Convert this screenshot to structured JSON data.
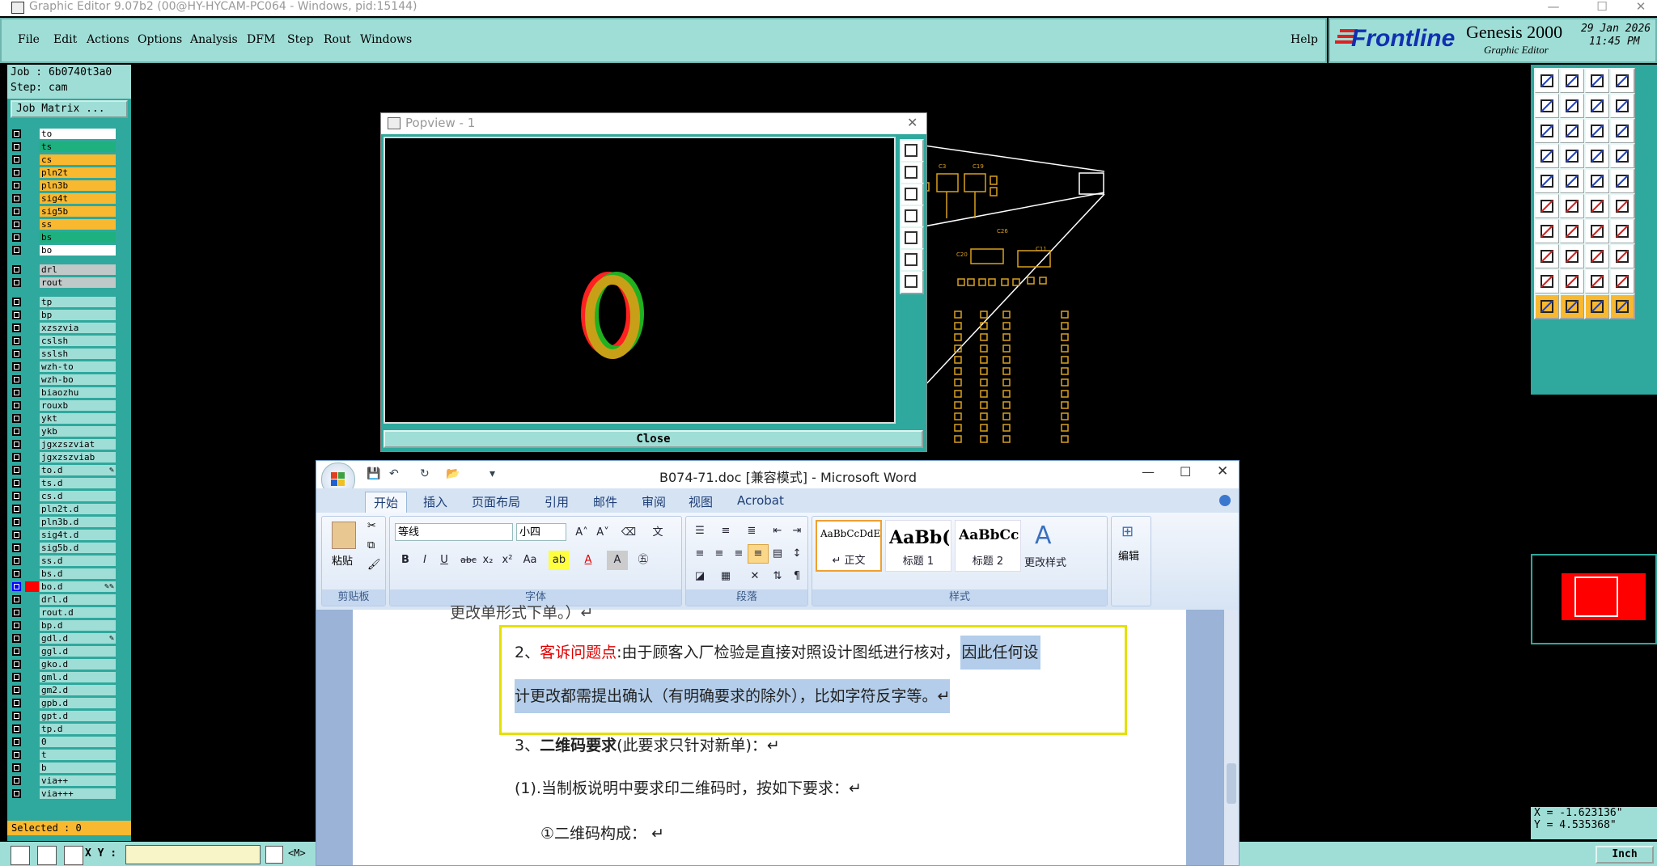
{
  "app": {
    "title": "Graphic Editor 9.07b2 (00@HY-HYCAM-PC064 - Windows, pid:15144)",
    "window_controls": [
      "—",
      "☐",
      "✕"
    ]
  },
  "menu": {
    "items": [
      "File",
      "Edit",
      "Actions",
      "Options",
      "Analysis",
      "DFM",
      "Step",
      "Rout",
      "Windows"
    ],
    "help": "Help"
  },
  "brand": {
    "logo": "Frontline",
    "product": "Genesis 2000",
    "subtitle": "Graphic Editor",
    "date": "29 Jan 2026",
    "time": "11:45 PM"
  },
  "job": {
    "job_line": "Job : 6b0740t3a0",
    "step_line": "Step: cam",
    "matrix_button": "Job Matrix ..."
  },
  "layers": [
    {
      "name": "to",
      "bg": "#ffffff",
      "col": "#2fa89d"
    },
    {
      "name": "ts",
      "bg": "#1fb080",
      "col": "#2fa89d"
    },
    {
      "name": "cs",
      "bg": "#f8b830",
      "col": "#2fa89d"
    },
    {
      "name": "pln2t",
      "bg": "#f8b830",
      "col": "#2fa89d"
    },
    {
      "name": "pln3b",
      "bg": "#f8b830",
      "col": "#2fa89d"
    },
    {
      "name": "sig4t",
      "bg": "#f8b830",
      "col": "#2fa89d"
    },
    {
      "name": "sig5b",
      "bg": "#f8b830",
      "col": "#2fa89d"
    },
    {
      "name": "ss",
      "bg": "#f8b830",
      "col": "#2fa89d"
    },
    {
      "name": "bs",
      "bg": "#1fb080",
      "col": "#2fa89d"
    },
    {
      "name": "bo",
      "bg": "#ffffff",
      "col": "#2fa89d"
    },
    {
      "name": "drl",
      "bg": "#c0c8c8",
      "col": "#2fa89d"
    },
    {
      "name": "rout",
      "bg": "#c0c8c8",
      "col": "#2fa89d"
    },
    {
      "name": "tp",
      "bg": "#9fded6",
      "col": "#2fa89d"
    },
    {
      "name": "bp",
      "bg": "#9fded6",
      "col": "#2fa89d"
    },
    {
      "name": "xzszvia",
      "bg": "#9fded6",
      "col": "#2fa89d"
    },
    {
      "name": "cslsh",
      "bg": "#9fded6",
      "col": "#2fa89d"
    },
    {
      "name": "sslsh",
      "bg": "#9fded6",
      "col": "#2fa89d"
    },
    {
      "name": "wzh-to",
      "bg": "#9fded6",
      "col": "#2fa89d"
    },
    {
      "name": "wzh-bo",
      "bg": "#9fded6",
      "col": "#2fa89d"
    },
    {
      "name": "biaozhu",
      "bg": "#9fded6",
      "col": "#2fa89d"
    },
    {
      "name": "rouxb",
      "bg": "#9fded6",
      "col": "#2fa89d"
    },
    {
      "name": "ykt",
      "bg": "#9fded6",
      "col": "#2fa89d"
    },
    {
      "name": "ykb",
      "bg": "#9fded6",
      "col": "#2fa89d"
    },
    {
      "name": "jgxzszviat",
      "bg": "#9fded6",
      "col": "#2fa89d"
    },
    {
      "name": "jgxzszviab",
      "bg": "#9fded6",
      "col": "#2fa89d"
    },
    {
      "name": "to.d",
      "bg": "#9fded6",
      "col": "#2fa89d",
      "mark": "✎"
    },
    {
      "name": "ts.d",
      "bg": "#9fded6",
      "col": "#2fa89d"
    },
    {
      "name": "cs.d",
      "bg": "#9fded6",
      "col": "#2fa89d"
    },
    {
      "name": "pln2t.d",
      "bg": "#9fded6",
      "col": "#2fa89d"
    },
    {
      "name": "pln3b.d",
      "bg": "#9fded6",
      "col": "#2fa89d"
    },
    {
      "name": "sig4t.d",
      "bg": "#9fded6",
      "col": "#2fa89d"
    },
    {
      "name": "sig5b.d",
      "bg": "#9fded6",
      "col": "#2fa89d"
    },
    {
      "name": "ss.d",
      "bg": "#9fded6",
      "col": "#2fa89d"
    },
    {
      "name": "bs.d",
      "bg": "#9fded6",
      "col": "#2fa89d"
    },
    {
      "name": "bo.d",
      "bg": "#9fded6",
      "col": "#ff0000",
      "mark": "✎✎",
      "chk": "#0000ff"
    },
    {
      "name": "drl.d",
      "bg": "#9fded6",
      "col": "#2fa89d"
    },
    {
      "name": "rout.d",
      "bg": "#9fded6",
      "col": "#2fa89d"
    },
    {
      "name": "bp.d",
      "bg": "#9fded6",
      "col": "#2fa89d"
    },
    {
      "name": "gdl.d",
      "bg": "#9fded6",
      "col": "#2fa89d",
      "mark": "✎"
    },
    {
      "name": "ggl.d",
      "bg": "#9fded6",
      "col": "#2fa89d"
    },
    {
      "name": "gko.d",
      "bg": "#9fded6",
      "col": "#2fa89d"
    },
    {
      "name": "gml.d",
      "bg": "#9fded6",
      "col": "#2fa89d"
    },
    {
      "name": "gm2.d",
      "bg": "#9fded6",
      "col": "#2fa89d"
    },
    {
      "name": "gpb.d",
      "bg": "#9fded6",
      "col": "#2fa89d"
    },
    {
      "name": "gpt.d",
      "bg": "#9fded6",
      "col": "#2fa89d"
    },
    {
      "name": "tp.d",
      "bg": "#9fded6",
      "col": "#2fa89d"
    },
    {
      "name": "0",
      "bg": "#9fded6",
      "col": "#2fa89d"
    },
    {
      "name": "t",
      "bg": "#9fded6",
      "col": "#2fa89d"
    },
    {
      "name": "b",
      "bg": "#9fded6",
      "col": "#2fa89d"
    },
    {
      "name": "via++",
      "bg": "#9fded6",
      "col": "#2fa89d"
    },
    {
      "name": "via+++",
      "bg": "#9fded6",
      "col": "#2fa89d"
    }
  ],
  "status": {
    "selected": "Selected : 0",
    "xy_label": "X Y :",
    "unit_toggle": "<M>",
    "units": "Inch",
    "x": "X = -1.623136\"",
    "y": "Y =  4.535368\""
  },
  "popview": {
    "title": "Popview - 1",
    "close_label": "Close"
  },
  "pcb_labels": [
    "C3",
    "C19",
    "C20",
    "C11",
    "C26"
  ],
  "word": {
    "title": "B074-71.doc [兼容模式] - Microsoft Word",
    "tabs": [
      "开始",
      "插入",
      "页面布局",
      "引用",
      "邮件",
      "审阅",
      "视图",
      "Acrobat"
    ],
    "font_name": "等线",
    "font_size": "小四",
    "groups": {
      "clipboard": "剪贴板",
      "font": "字体",
      "paragraph": "段落",
      "styles": "样式"
    },
    "paste": "粘贴",
    "styles": [
      {
        "preview": "AaBbCcDdEe",
        "name": "↵ 正文"
      },
      {
        "preview": "AaBb(",
        "name": "标题 1"
      },
      {
        "preview": "AaBbCc",
        "name": "标题 2"
      }
    ],
    "change_styles": "更改样式",
    "edit": "编辑",
    "doc": {
      "line0": "更改单形式下单。）↵",
      "p2_num": "2、",
      "p2_title": "客诉问题点",
      "p2_body": ":由于顾客入厂检验是直接对照设计图纸进行核对，",
      "p2_hl1": "因此任何设",
      "p2_hl2": "计更改都需提出确认（有明确要求的除外），比如字符反字等。↵",
      "p3_num": "3、",
      "p3_title": "二维码要求",
      "p3_body": "(此要求只针对新单)：↵",
      "p4": "(1).当制板说明中要求印二维码时，按如下要求：↵",
      "p5": "①二维码构成：  ↵"
    }
  }
}
